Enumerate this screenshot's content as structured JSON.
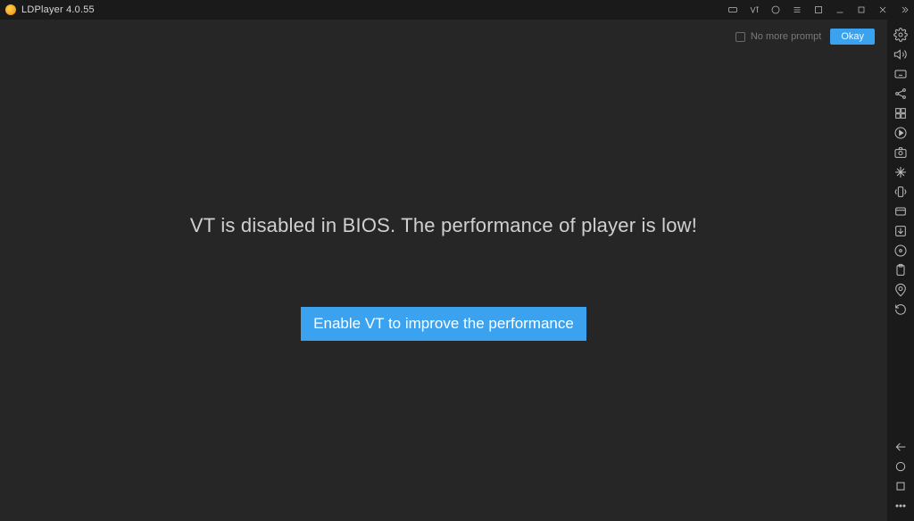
{
  "titlebar": {
    "title": "LDPlayer 4.0.55",
    "icons": [
      {
        "name": "keyboard-icon"
      },
      {
        "name": "vt-status-icon"
      },
      {
        "name": "record-icon"
      },
      {
        "name": "menu-icon"
      },
      {
        "name": "fullscreen-icon"
      },
      {
        "name": "minimize-icon"
      },
      {
        "name": "maximize-icon"
      },
      {
        "name": "close-icon"
      },
      {
        "name": "collapse-icon"
      }
    ]
  },
  "notice": {
    "checkbox_label": "No more prompt",
    "okay_label": "Okay"
  },
  "message": {
    "main": "VT is disabled in BIOS. The performance of player is low!",
    "button": "Enable VT to improve the performance"
  },
  "sidebar_top": [
    {
      "name": "settings-icon"
    },
    {
      "name": "volume-icon"
    },
    {
      "name": "keymap-icon"
    },
    {
      "name": "multi-instance-icon"
    },
    {
      "name": "sync-icon"
    },
    {
      "name": "record-start-icon"
    },
    {
      "name": "screenshot-icon"
    },
    {
      "name": "operation-icon"
    },
    {
      "name": "shake-icon"
    },
    {
      "name": "shared-folder-icon"
    },
    {
      "name": "apk-install-icon"
    },
    {
      "name": "disc-icon"
    },
    {
      "name": "clipboard-icon"
    },
    {
      "name": "location-icon"
    },
    {
      "name": "rotate-icon"
    }
  ],
  "sidebar_bottom": [
    {
      "name": "back-icon"
    },
    {
      "name": "home-icon"
    },
    {
      "name": "recents-icon"
    },
    {
      "name": "more-icon"
    }
  ]
}
